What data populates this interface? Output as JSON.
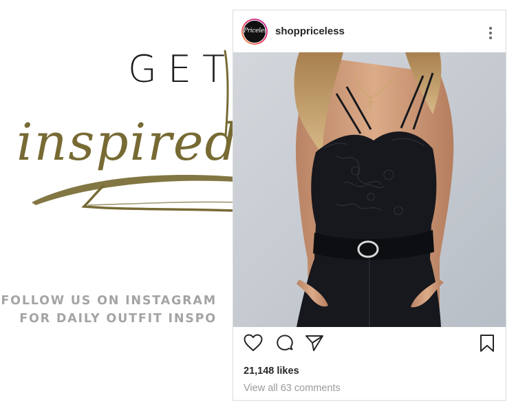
{
  "promo": {
    "heading": "GET",
    "script_word": "inspired",
    "cta_line1": "FOLLOW US ON INSTAGRAM",
    "cta_line2": "FOR DAILY OUTFIT INSPO"
  },
  "post": {
    "username": "shoppriceless",
    "avatar_text": "Priceless",
    "likes": "21,148 likes",
    "comments_link": "View all 63 comments"
  },
  "colors": {
    "script_gold": "#776a33",
    "cta_gray": "#a4a4a4",
    "photo_background": "#c8cdd3",
    "bodysuit": "#17181d",
    "skin": "#d29f7c"
  },
  "icons": {
    "heart": "heart-icon",
    "comment": "comment-icon",
    "share": "paper-plane-icon",
    "save": "bookmark-icon",
    "more": "more-options-icon"
  }
}
